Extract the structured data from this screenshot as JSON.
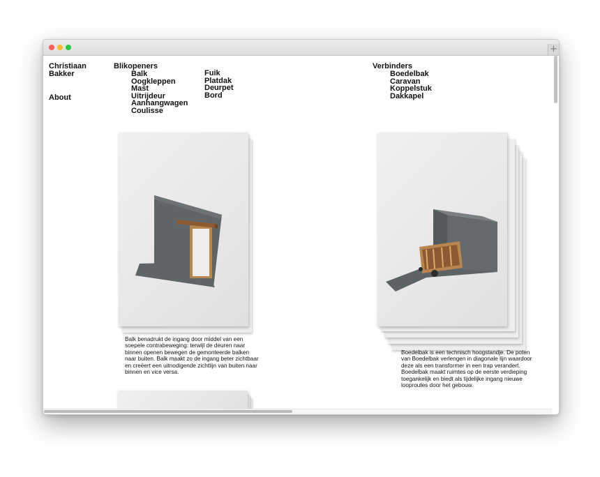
{
  "nav": {
    "studio_name_line1": "Christiaan",
    "studio_name_line2": "Bakker",
    "about": "About",
    "group1": {
      "title": "Blikopeners",
      "col1": [
        "Balk",
        "Oogkleppen",
        "Mast",
        "Uitrijdeur",
        "Aanhangwagen",
        "Coulisse"
      ],
      "col2": [
        "Fuik",
        "Platdak",
        "Deurpet",
        "Bord"
      ]
    },
    "group2": {
      "title": "Verbinders",
      "items": [
        "Boedelbak",
        "Caravan",
        "Koppelstuk",
        "Dakkapel"
      ]
    }
  },
  "projects": [
    {
      "name": "Balk",
      "caption": "Balk benadrukt de ingang door middel van een soepele contrabeweging: terwijl de deuren naar binnen openen bewegen de gemonteerde balken naar buiten. Balk maakt zo de ingang beter zichtbaar en creëert een uitnodigende zichtlijn van buiten naar binnen en vice versa."
    },
    {
      "name": "Boedelbak",
      "caption": "Boedelbak is een technisch hoogstandje. De poten van Boedelbak verlengen in diagonale lijn waardoor deze als een transformer in een trap verandert. Boedelbak maakt ruimtes op de eerste verdieping toegankelijk en biedt als tijdelijke ingang nieuwe looproutes door het gebouw."
    }
  ],
  "colors": {
    "model_grey": "#5f6466",
    "wood": "#b8874f",
    "traffic_red": "#fc5f57",
    "traffic_yellow": "#fdbc2e",
    "traffic_green": "#2bc840"
  },
  "window_controls": {
    "new_tab_label": "+"
  }
}
